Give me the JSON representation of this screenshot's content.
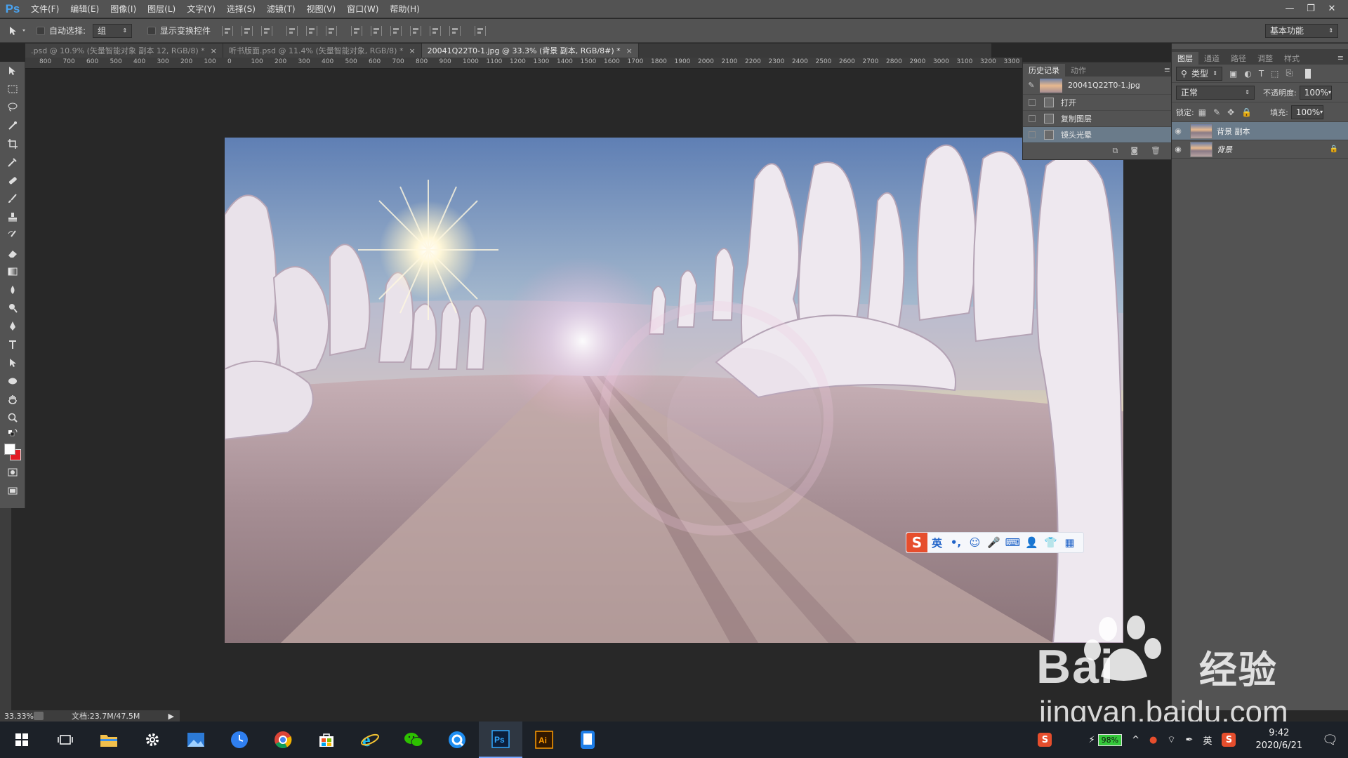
{
  "app": {
    "logo": "Ps",
    "menus": [
      "文件(F)",
      "编辑(E)",
      "图像(I)",
      "图层(L)",
      "文字(Y)",
      "选择(S)",
      "滤镜(T)",
      "视图(V)",
      "窗口(W)",
      "帮助(H)"
    ]
  },
  "options": {
    "auto_select_label": "自动选择:",
    "auto_select_value": "组",
    "show_transform_label": "显示变换控件",
    "workspace": "基本功能"
  },
  "tabs": [
    {
      "label": ".psd @ 10.9% (矢量智能对象 副本 12, RGB/8) *",
      "close": "×"
    },
    {
      "label": "听书版面.psd @ 11.4% (矢量智能对象, RGB/8) *",
      "close": "×"
    },
    {
      "label": "20041Q22T0-1.jpg @ 33.3% (背景 副本, RGB/8#) *",
      "close": "×"
    }
  ],
  "ruler": {
    "ticks": [
      "800",
      "700",
      "600",
      "500",
      "400",
      "300",
      "200",
      "100",
      "0",
      "100",
      "200",
      "300",
      "400",
      "500",
      "600",
      "700",
      "800",
      "900",
      "1000",
      "1100",
      "1200",
      "1300",
      "1400",
      "1500",
      "1600",
      "1700",
      "1800",
      "1900",
      "2000",
      "2100",
      "2200",
      "2300",
      "2400",
      "2500",
      "2600",
      "2700",
      "2800",
      "2900",
      "3000",
      "3100",
      "3200",
      "3300"
    ]
  },
  "status": {
    "zoom": "33.33%",
    "doc_size": "文档:23.7M/47.5M"
  },
  "history": {
    "tabs": [
      "历史记录",
      "动作"
    ],
    "snapshot": "20041Q22T0-1.jpg",
    "items": [
      "打开",
      "复制图层",
      "镜头光晕"
    ]
  },
  "layers": {
    "tabs": [
      "图层",
      "通道",
      "路径",
      "调整",
      "样式"
    ],
    "filter_label": "类型",
    "blend_mode": "正常",
    "opacity_label": "不透明度:",
    "opacity": "100%",
    "lock_label": "锁定:",
    "fill_label": "填充:",
    "fill": "100%",
    "items": [
      {
        "name": "背景 副本",
        "selected": true
      },
      {
        "name": "背景",
        "selected": false
      }
    ]
  },
  "ime": {
    "logo": "S",
    "mode": "英",
    "punct": "•,"
  },
  "watermark": {
    "brand": "Bai",
    "brand_tail": "经验",
    "url": "jingyan.baidu.com"
  },
  "taskbar": {
    "battery": "98%",
    "ime": "英",
    "time": "9:42",
    "date": "2020/6/21"
  }
}
